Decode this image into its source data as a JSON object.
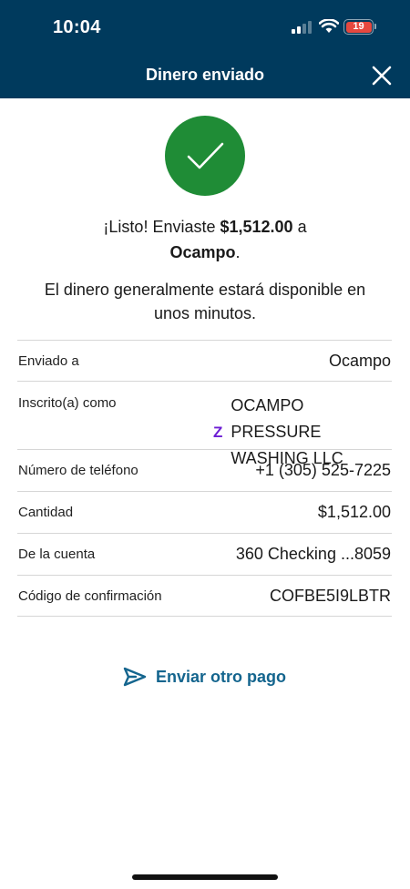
{
  "status_bar": {
    "time": "10:04",
    "battery": "19"
  },
  "header": {
    "title": "Dinero enviado"
  },
  "confirmation": {
    "prefix": "¡Listo! Enviaste ",
    "amount": "$1,512.00",
    "middle": " a",
    "recipient": "Ocampo",
    "suffix": ".",
    "availability": "El dinero generalmente estará disponible en unos minutos."
  },
  "details": [
    {
      "label": "Enviado a",
      "value": "Ocampo"
    },
    {
      "label": "Inscrito(a) como",
      "value_line1": "OCAMPO PRESSURE",
      "value_line2": "WASHING LLC",
      "badge": "Z"
    },
    {
      "label": "Número de teléfono",
      "value": "+1 (305) 525-7225"
    },
    {
      "label": "Cantidad",
      "value": "$1,512.00"
    },
    {
      "label": "De la cuenta",
      "value": "360 Checking ...8059"
    },
    {
      "label": "Código de confirmación",
      "value": "COFBE5I9LBTR"
    }
  ],
  "actions": {
    "send_again": "Enviar otro pago"
  },
  "colors": {
    "header_bg": "#003a5d",
    "success": "#1f8c36",
    "link": "#14658e",
    "zelle": "#6d1ed4"
  },
  "icons": {
    "close": "close-icon",
    "check": "checkmark-icon",
    "send": "paper-plane-icon",
    "zelle": "zelle-icon"
  }
}
